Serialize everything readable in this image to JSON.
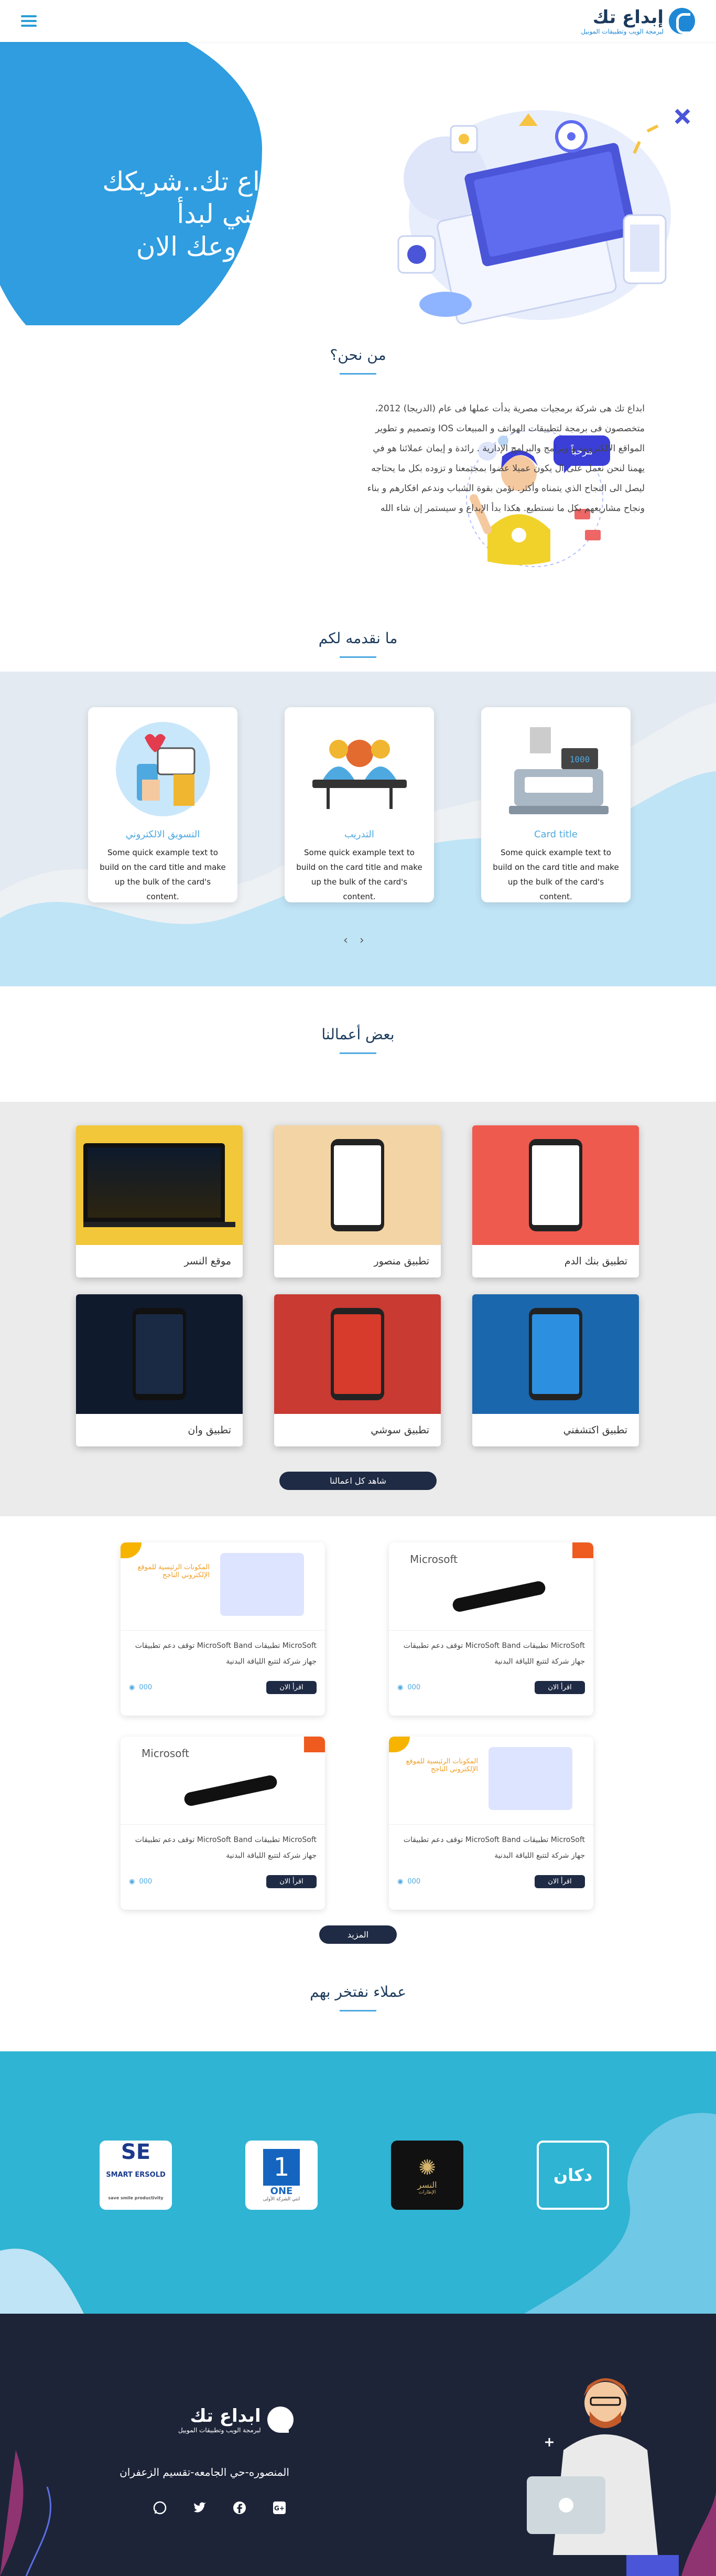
{
  "header": {
    "logo_title": "إبداع تك",
    "logo_subtitle": "لبرمجة الويب وتطبيقات الموبيل",
    "menu_icon": "hamburger-icon"
  },
  "hero": {
    "headline": "ابداع تك..شريكك التقني لبدأ مشروعك الان"
  },
  "about": {
    "title": "من نحن؟",
    "bubble": "مرحباً",
    "text": "ابداع تك هى شركة برمجيات مصرية بدأت عملها فى عام (الدريجا) 2012، متخصصون فى برمجة لتطبيقات الهواتف و المبيعات IOS وتصميم و تطوير المواقع الالكترونية و وبرامج والبرامج الإدارية . رائدة و إيمان عملائنا هو في يهمنا لنحن نعمل على ال يكون عميلا عضوا بمجتمعنا و تزوده بكل ما يحتاجه ليصل الى النجاح الذي يتمناه وأكثر. نؤمن بقوة الشباب وندعم افكارهم و بناء ونجاح مشاريعهم بكل ما نستطيع. هكذا بدأ الإبداع و سيستمر إن شاء الله"
  },
  "services": {
    "title": "ما نقدمه لكم",
    "cards": [
      {
        "title": "التسويق الالكتروني",
        "text": "Some quick example text to build on the card title and make up the bulk of the card's content."
      },
      {
        "title": "التدريب",
        "text": "Some quick example text to build on the card title and make up the bulk of the card's content."
      },
      {
        "title": "Card title",
        "text": "Some quick example text to build on the card title and make up the bulk of the card's content."
      }
    ],
    "prev": "‹",
    "next": "›"
  },
  "works": {
    "title": "بعض أعمالنا",
    "items": [
      {
        "label": "موقع النسر"
      },
      {
        "label": "تطبيق منصور"
      },
      {
        "label": "تطبيق بنك الدم"
      },
      {
        "label": "تطبيق وان"
      },
      {
        "label": "تطبيق سوشي"
      },
      {
        "label": "تطبيق اكتشفني"
      }
    ],
    "see_all": "شاهد كل اعمالنا"
  },
  "blog": {
    "posts": [
      {
        "text": "MicroSoft تطبيقات MicroSoft Band توقف دعم تطبيقات جهاز شركة لتتبع اللياقة البدنية",
        "button": "اقرأ الان",
        "views": "000",
        "img_title": "المكونات الرئيسية للموقع الإلكتروني الناجح"
      },
      {
        "text": "MicroSoft تطبيقات MicroSoft Band توقف دعم تطبيقات جهاز شركة لتتبع اللياقة البدنية",
        "button": "اقرأ الان",
        "views": "000",
        "img_title": "Microsoft"
      },
      {
        "text": "MicroSoft تطبيقات MicroSoft Band توقف دعم تطبيقات جهاز شركة لتتبع اللياقة البدنية",
        "button": "اقرأ الان",
        "views": "000",
        "img_title": "Microsoft"
      },
      {
        "text": "MicroSoft تطبيقات MicroSoft Band توقف دعم تطبيقات جهاز شركة لتتبع اللياقة البدنية",
        "button": "اقرأ الان",
        "views": "000",
        "img_title": "المكونات الرئيسية للموقع الإلكتروني الناجح"
      }
    ],
    "more": "المزيد"
  },
  "clients": {
    "title": "عملاء نفتخر بهم",
    "logos": [
      {
        "name": "SMART ERSOLD",
        "sub": "save smile productivity"
      },
      {
        "name": "ONE",
        "sub": "انتي الشركة الأولى"
      },
      {
        "name": "النسر",
        "sub": "الإطارات"
      },
      {
        "name": "دكان",
        "sub": ""
      }
    ]
  },
  "footer": {
    "logo_title": "ابداع تك",
    "logo_subtitle": "لبرمجة الويب وتطبيقات الموبيل",
    "address": "المنصوره-حي الجامعه-تقسيم الزعفران",
    "social": [
      "google-plus-icon",
      "facebook-icon",
      "twitter-icon",
      "whatsapp-icon"
    ]
  },
  "colors": {
    "primary": "#2f9de0",
    "dark": "#1f2a44",
    "clients_bg": "#2fb4d3",
    "footer_bg": "#1d2438"
  }
}
